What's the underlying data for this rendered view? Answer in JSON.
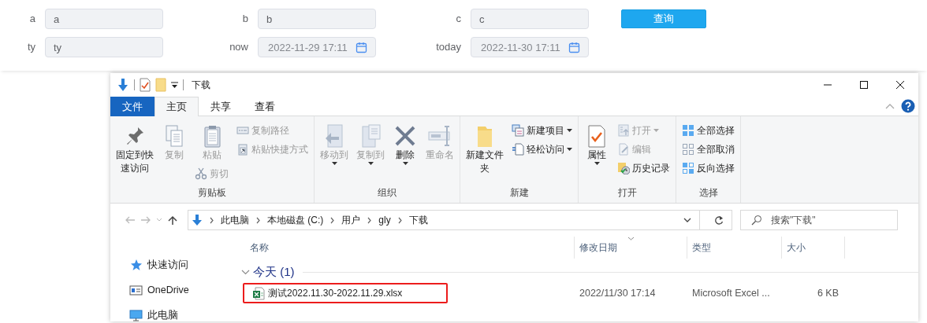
{
  "form": {
    "fields": [
      {
        "label": "a",
        "value": "a",
        "kind": "text"
      },
      {
        "label": "b",
        "value": "b",
        "kind": "text"
      },
      {
        "label": "c",
        "value": "c",
        "kind": "text"
      },
      {
        "label": "ty",
        "value": "ty",
        "kind": "text"
      },
      {
        "label": "now",
        "value": "2022-11-29 17:11",
        "kind": "date"
      },
      {
        "label": "today",
        "value": "2022-11-30 17:11",
        "kind": "date"
      }
    ],
    "submit": "查询"
  },
  "explorer": {
    "title": "下载",
    "tabs": [
      {
        "label": "文件",
        "kind": "file",
        "selected": false
      },
      {
        "label": "主页",
        "kind": "tab",
        "selected": true
      },
      {
        "label": "共享",
        "kind": "tab",
        "selected": false
      },
      {
        "label": "查看",
        "kind": "tab",
        "selected": false
      }
    ],
    "ribbon": [
      {
        "label": "剪贴板",
        "columns": [
          [
            {
              "label": "固定到快速访问",
              "kind": "large",
              "disabled": false,
              "dropdown": false
            }
          ],
          [
            {
              "label": "复制",
              "kind": "large",
              "disabled": true,
              "dropdown": false
            }
          ],
          [
            {
              "label": "粘贴",
              "kind": "large",
              "disabled": true,
              "dropdown": false
            },
            {
              "label": "剪切",
              "kind": "small",
              "disabled": true,
              "dropdown": false
            }
          ],
          [
            {
              "label": "复制路径",
              "kind": "small",
              "disabled": true,
              "dropdown": false
            },
            {
              "label": "粘贴快捷方式",
              "kind": "small",
              "disabled": true,
              "dropdown": false
            }
          ]
        ]
      },
      {
        "label": "组织",
        "columns": [
          [
            {
              "label": "移动到",
              "kind": "large",
              "disabled": true,
              "dropdown": true
            }
          ],
          [
            {
              "label": "复制到",
              "kind": "large",
              "disabled": true,
              "dropdown": true
            }
          ],
          [
            {
              "label": "删除",
              "kind": "large",
              "disabled": false,
              "dropdown": true
            }
          ],
          [
            {
              "label": "重命名",
              "kind": "large",
              "disabled": true,
              "dropdown": false
            }
          ]
        ]
      },
      {
        "label": "新建",
        "columns": [
          [
            {
              "label": "新建文件夹",
              "kind": "large",
              "disabled": false,
              "dropdown": false
            }
          ],
          [
            {
              "label": "新建项目",
              "kind": "small",
              "disabled": false,
              "dropdown": true
            },
            {
              "label": "轻松访问",
              "kind": "small",
              "disabled": false,
              "dropdown": true
            }
          ]
        ]
      },
      {
        "label": "打开",
        "columns": [
          [
            {
              "label": "属性",
              "kind": "large",
              "disabled": false,
              "dropdown": true
            }
          ],
          [
            {
              "label": "打开",
              "kind": "small",
              "disabled": true,
              "dropdown": true
            },
            {
              "label": "编辑",
              "kind": "small",
              "disabled": true,
              "dropdown": false
            },
            {
              "label": "历史记录",
              "kind": "small",
              "disabled": false,
              "dropdown": false
            }
          ]
        ]
      },
      {
        "label": "选择",
        "columns": [
          [
            {
              "label": "全部选择",
              "kind": "small",
              "disabled": false,
              "dropdown": false
            },
            {
              "label": "全部取消",
              "kind": "small",
              "disabled": false,
              "dropdown": false
            },
            {
              "label": "反向选择",
              "kind": "small",
              "disabled": false,
              "dropdown": false
            }
          ]
        ]
      }
    ],
    "address": [
      "此电脑",
      "本地磁盘 (C:)",
      "用户",
      "gly",
      "下载"
    ],
    "search": {
      "placeholder": "搜索\"下载\""
    },
    "sidebar": [
      {
        "label": "快速访问"
      },
      {
        "label": "OneDrive"
      },
      {
        "label": "此电脑"
      }
    ],
    "columns": [
      "名称",
      "修改日期",
      "类型",
      "大小"
    ],
    "groups": [
      {
        "label": "今天 (1)",
        "expanded": true,
        "files": [
          {
            "name": "测试2022.11.30-2022.11.29.xlsx",
            "modified": "2022/11/30 17:14",
            "type": "Microsoft Excel ...",
            "size": "6 KB",
            "highlighted": true
          }
        ]
      }
    ]
  }
}
